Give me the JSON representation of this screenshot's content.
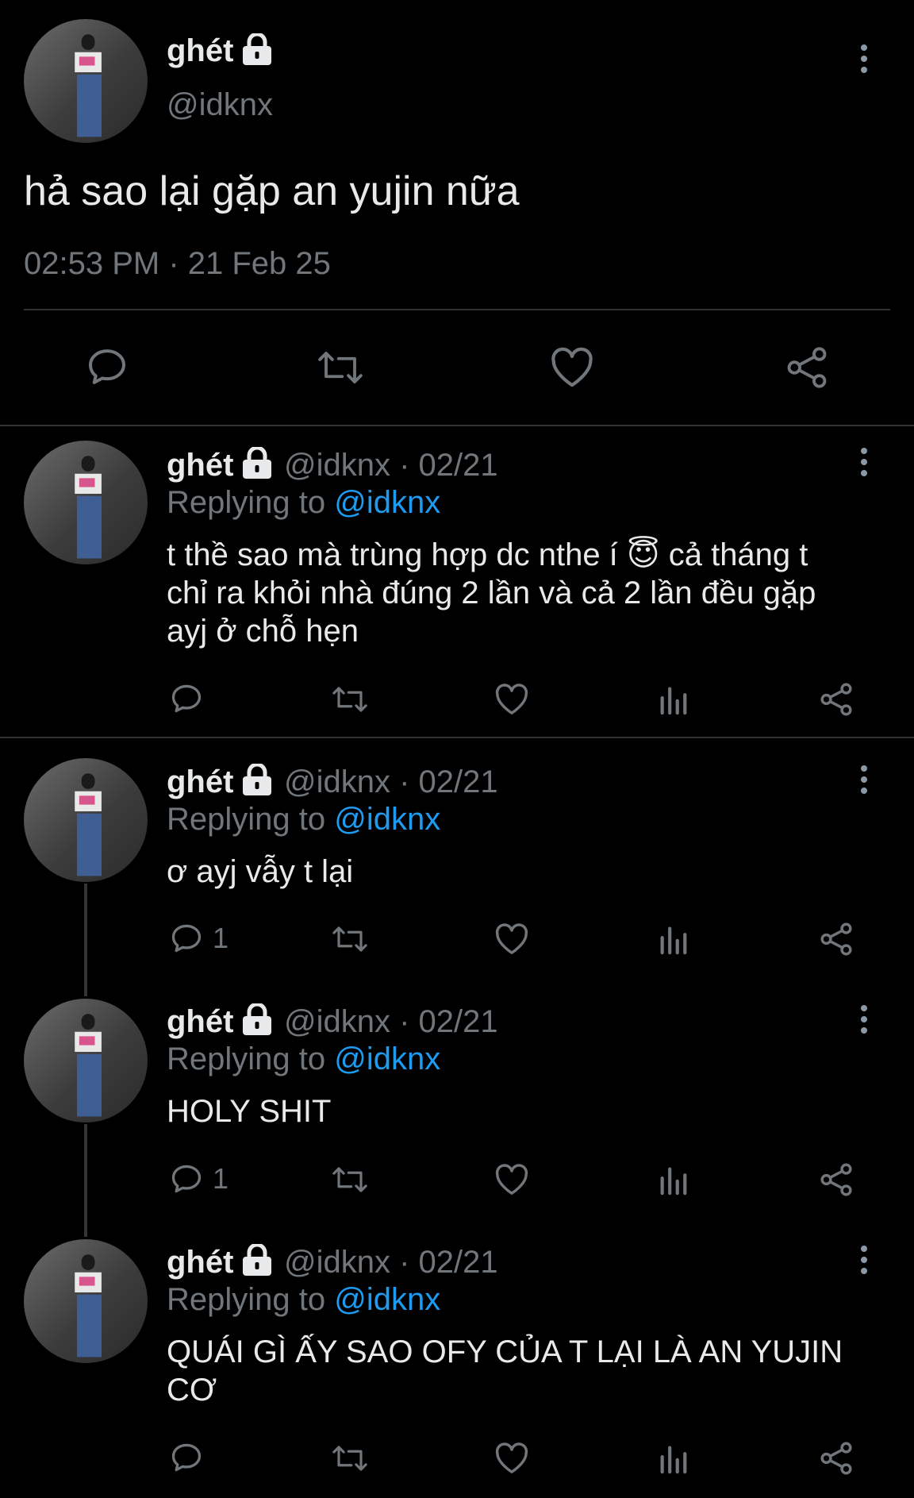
{
  "main_tweet": {
    "display_name": "ghét",
    "handle": "@idknx",
    "text": "hả sao lại gặp an yujin nữa",
    "timestamp": "02:53 PM · 21 Feb 25"
  },
  "replies": [
    {
      "display_name": "ghét",
      "handle_date": "@idknx · 02/21",
      "replying_prefix": "Replying to",
      "replying_handle": "@idknx",
      "text_line1": "t thề sao mà trùng hợp dc nthe í 😇 cả tháng t",
      "text_line2": "chỉ ra khỏi nhà đúng 2 lần và cả 2 lần đều gặp",
      "text_line3": "ayj ở chỗ hẹn",
      "reply_count": ""
    },
    {
      "display_name": "ghét",
      "handle_date": "@idknx · 02/21",
      "replying_prefix": "Replying to",
      "replying_handle": "@idknx",
      "text_line1": "ơ ayj vẫy t lại",
      "reply_count": "1"
    },
    {
      "display_name": "ghét",
      "handle_date": "@idknx · 02/21",
      "replying_prefix": "Replying to",
      "replying_handle": "@idknx",
      "text_line1": "HOLY SHIT",
      "reply_count": "1"
    },
    {
      "display_name": "ghét",
      "handle_date": "@idknx · 02/21",
      "replying_prefix": "Replying to",
      "replying_handle": "@idknx",
      "text_line1": "QUÁI GÌ ẤY SAO OFY CỦA T LẠI LÀ AN YUJIN",
      "text_line2": "CƠ",
      "reply_count": ""
    }
  ],
  "icons": [
    "lock-icon",
    "more-icon",
    "reply-icon",
    "retweet-icon",
    "like-icon",
    "analytics-icon",
    "share-icon"
  ],
  "colors": {
    "background": "#000000",
    "text": "#e7e9ea",
    "muted": "#71767b",
    "link": "#1d9bf0",
    "divider": "#2f3336"
  }
}
